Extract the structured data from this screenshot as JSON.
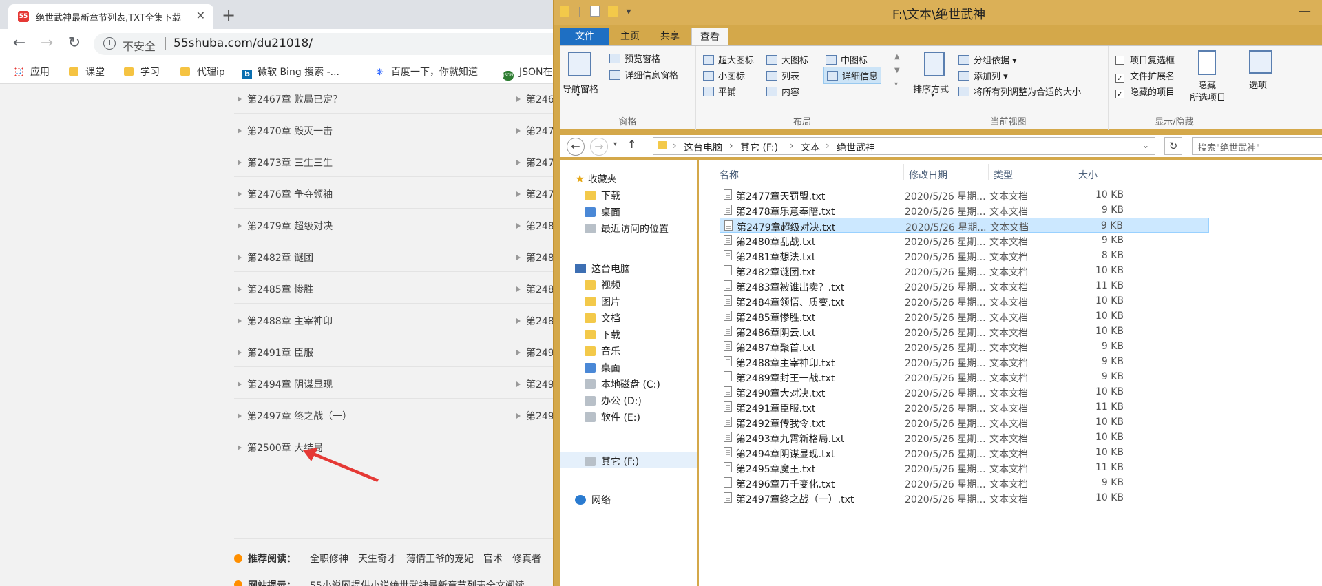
{
  "browser": {
    "tab_title": "绝世武神最新章节列表,TXT全集下载",
    "tab_favicon_text": "55",
    "security_label": "不安全",
    "url": "55shuba.com/du21018/",
    "bookmarks": [
      "应用",
      "课堂",
      "学习",
      "代理ip",
      "微软 Bing 搜索 -...",
      "百度一下，你就知道",
      "JSON在"
    ],
    "chapters_left": [
      "第2467章 败局已定？",
      "第2470章 毁灭一击",
      "第2473章 三生三生",
      "第2476章 争夺领袖",
      "第2479章 超级对决",
      "第2482章 谜团",
      "第2485章 惨胜",
      "第2488章 主宰神印",
      "第2491章 臣服",
      "第2494章 阴谋显现",
      "第2497章 终之战（一）",
      "第2500章 大结局"
    ],
    "chapters_right": [
      "第246",
      "第247",
      "第247",
      "第247",
      "第248",
      "第248",
      "第248",
      "第248",
      "第249",
      "第249",
      "第249"
    ],
    "recommend_label": "推荐阅读：",
    "recommend_links": [
      "全职修神",
      "天生奇才",
      "薄情王爷的宠妃",
      "官术",
      "修真者"
    ],
    "notice_label": "网站提示：",
    "notice_text": "55小说网提供小说绝世武神最新章节列表全文阅读"
  },
  "explorer": {
    "title": "F:\\文本\\绝世武神",
    "ribbon_tabs": [
      "文件",
      "主页",
      "共享",
      "查看"
    ],
    "active_tab": "查看",
    "groups": {
      "panes": {
        "label": "窗格",
        "nav_pane": "导航窗格",
        "preview_pane": "预览窗格",
        "details_pane": "详细信息窗格"
      },
      "layout": {
        "label": "布局",
        "items": [
          "超大图标",
          "大图标",
          "中图标",
          "小图标",
          "列表",
          "详细信息",
          "平铺",
          "内容"
        ],
        "selected": "详细信息"
      },
      "current_view": {
        "label": "当前视图",
        "sort": "排序方式",
        "group_by": "分组依据",
        "add_column": "添加列",
        "fit_columns": "将所有列调整为合适的大小"
      },
      "show_hide": {
        "label": "显示/隐藏",
        "item_checkboxes": "项目复选框",
        "file_ext": "文件扩展名",
        "hidden_items": "隐藏的项目",
        "hide_selected": "隐藏",
        "hide_selected2": "所选项目",
        "item_checkboxes_checked": false,
        "file_ext_checked": true,
        "hidden_items_checked": true
      },
      "options": {
        "label": "选项"
      }
    },
    "breadcrumb": [
      "这台电脑",
      "其它 (F:)",
      "文本",
      "绝世武神"
    ],
    "search_placeholder": "搜索\"绝世武神\"",
    "nav": {
      "favorites": "收藏夹",
      "fav_items": [
        "下载",
        "桌面",
        "最近访问的位置"
      ],
      "this_pc": "这台电脑",
      "pc_items": [
        "视频",
        "图片",
        "文档",
        "下载",
        "音乐",
        "桌面"
      ],
      "drives": [
        "本地磁盘 (C:)",
        "办公 (D:)",
        "软件 (E:)",
        "其它 (F:)"
      ],
      "network": "网络"
    },
    "columns": [
      "名称",
      "修改日期",
      "类型",
      "大小"
    ],
    "files": [
      {
        "name": "第2477章天罚盟.txt",
        "date": "2020/5/26 星期...",
        "type": "文本文档",
        "size": "10 KB"
      },
      {
        "name": "第2478章乐意奉陪.txt",
        "date": "2020/5/26 星期...",
        "type": "文本文档",
        "size": "9 KB"
      },
      {
        "name": "第2479章超级对决.txt",
        "date": "2020/5/26 星期...",
        "type": "文本文档",
        "size": "9 KB"
      },
      {
        "name": "第2480章乱战.txt",
        "date": "2020/5/26 星期...",
        "type": "文本文档",
        "size": "9 KB"
      },
      {
        "name": "第2481章想法.txt",
        "date": "2020/5/26 星期...",
        "type": "文本文档",
        "size": "8 KB"
      },
      {
        "name": "第2482章谜团.txt",
        "date": "2020/5/26 星期...",
        "type": "文本文档",
        "size": "10 KB"
      },
      {
        "name": "第2483章被谁出卖？.txt",
        "date": "2020/5/26 星期...",
        "type": "文本文档",
        "size": "11 KB"
      },
      {
        "name": "第2484章领悟、质变.txt",
        "date": "2020/5/26 星期...",
        "type": "文本文档",
        "size": "10 KB"
      },
      {
        "name": "第2485章惨胜.txt",
        "date": "2020/5/26 星期...",
        "type": "文本文档",
        "size": "10 KB"
      },
      {
        "name": "第2486章阴云.txt",
        "date": "2020/5/26 星期...",
        "type": "文本文档",
        "size": "10 KB"
      },
      {
        "name": "第2487章聚首.txt",
        "date": "2020/5/26 星期...",
        "type": "文本文档",
        "size": "9 KB"
      },
      {
        "name": "第2488章主宰神印.txt",
        "date": "2020/5/26 星期...",
        "type": "文本文档",
        "size": "9 KB"
      },
      {
        "name": "第2489章封王一战.txt",
        "date": "2020/5/26 星期...",
        "type": "文本文档",
        "size": "9 KB"
      },
      {
        "name": "第2490章大对决.txt",
        "date": "2020/5/26 星期...",
        "type": "文本文档",
        "size": "10 KB"
      },
      {
        "name": "第2491章臣服.txt",
        "date": "2020/5/26 星期...",
        "type": "文本文档",
        "size": "11 KB"
      },
      {
        "name": "第2492章传我令.txt",
        "date": "2020/5/26 星期...",
        "type": "文本文档",
        "size": "10 KB"
      },
      {
        "name": "第2493章九霄新格局.txt",
        "date": "2020/5/26 星期...",
        "type": "文本文档",
        "size": "10 KB"
      },
      {
        "name": "第2494章阴谋显现.txt",
        "date": "2020/5/26 星期...",
        "type": "文本文档",
        "size": "10 KB"
      },
      {
        "name": "第2495章魔王.txt",
        "date": "2020/5/26 星期...",
        "type": "文本文档",
        "size": "11 KB"
      },
      {
        "name": "第2496章万千变化.txt",
        "date": "2020/5/26 星期...",
        "type": "文本文档",
        "size": "9 KB"
      },
      {
        "name": "第2497章终之战（一）.txt",
        "date": "2020/5/26 星期...",
        "type": "文本文档",
        "size": "10 KB"
      }
    ],
    "selected_file": "第2479章超级对决.txt"
  }
}
